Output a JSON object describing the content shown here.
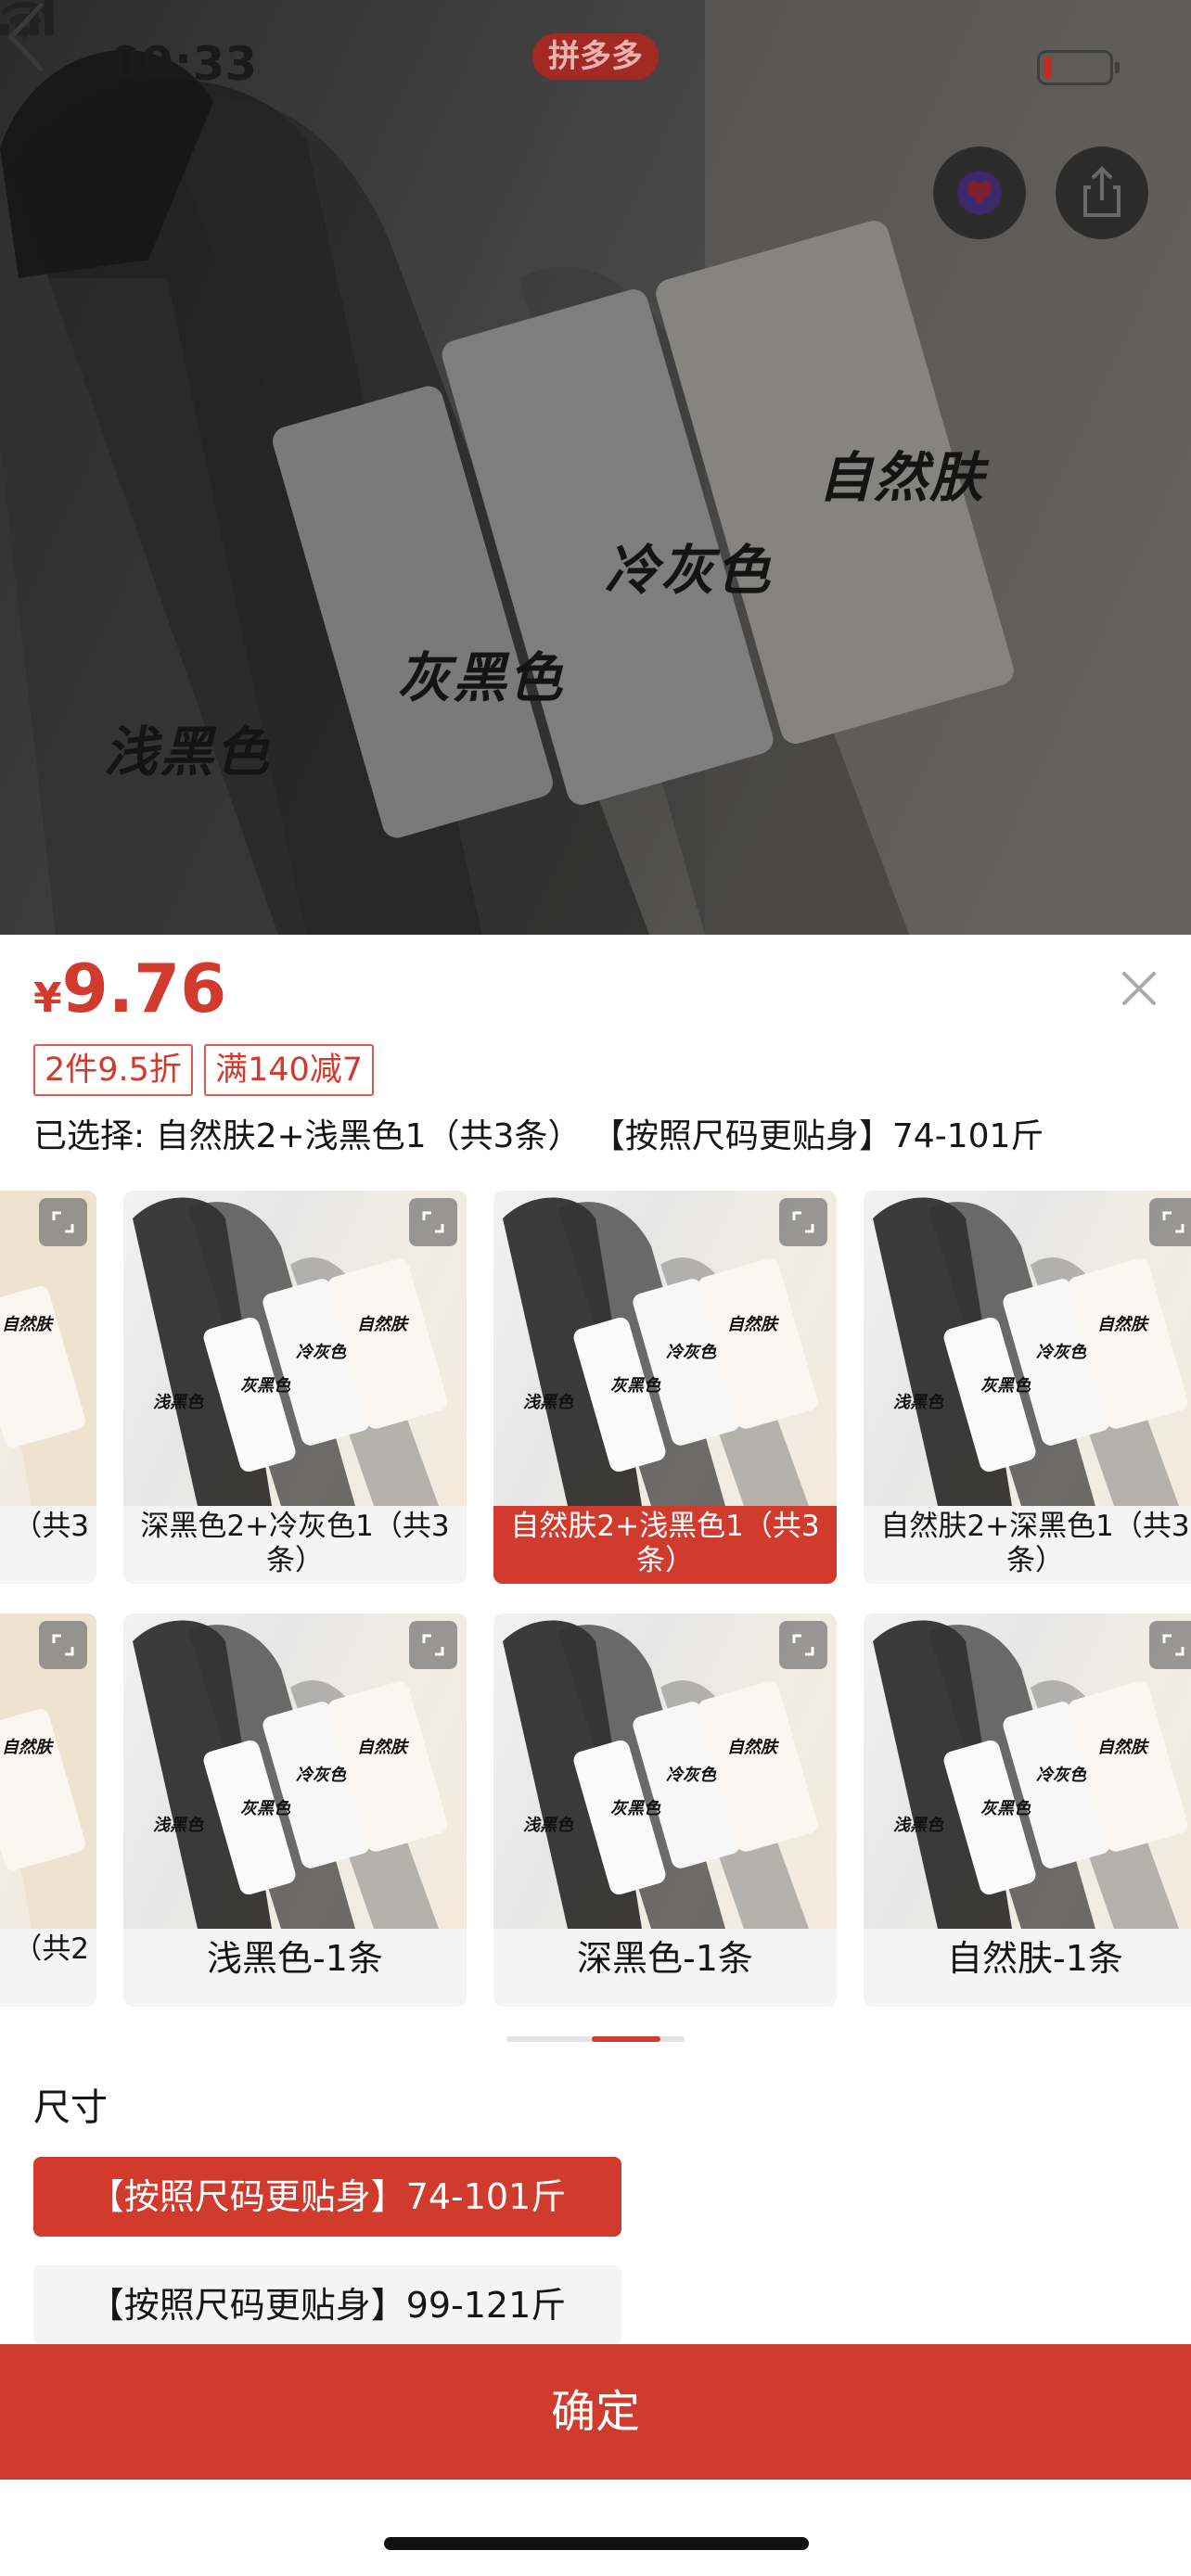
{
  "status_bar": {
    "time": "09:33",
    "app_badge": "拼多多"
  },
  "hero": {
    "labels": [
      "自然肤",
      "冷灰色",
      "灰黑色",
      "浅黑色"
    ]
  },
  "icons": {
    "back": "chevron-left-icon",
    "favorite": "heart-icon",
    "share": "share-icon",
    "close": "close-icon",
    "expand": "expand-icon"
  },
  "product": {
    "currency": "¥",
    "price": "9.76",
    "tags": [
      "2件9.5折",
      "满140减7"
    ],
    "selected_text": "已选择: 自然肤2+浅黑色1（共3条） 【按照尺码更贴身】74-101斤"
  },
  "thumb_labels": {
    "natural": "自然肤",
    "grey": "冷灰色",
    "greyblack": "灰黑色",
    "lightblack": "浅黑色"
  },
  "options_row1": [
    {
      "label": "（共3",
      "selected": false
    },
    {
      "label": "深黑色2+冷灰色1（共3条）",
      "selected": false
    },
    {
      "label": "自然肤2+浅黑色1（共3条）",
      "selected": true
    },
    {
      "label": "自然肤2+深黑色1（共3条）",
      "selected": false
    }
  ],
  "options_row2": [
    {
      "label": "（共2",
      "selected": false
    },
    {
      "label": "浅黑色-1条",
      "selected": false
    },
    {
      "label": "深黑色-1条",
      "selected": false
    },
    {
      "label": "自然肤-1条",
      "selected": false
    }
  ],
  "size": {
    "title": "尺寸",
    "options": [
      {
        "label": "【按照尺码更贴身】74-101斤",
        "selected": true
      },
      {
        "label": "【按照尺码更贴身】99-121斤",
        "selected": false
      }
    ]
  },
  "confirm_label": "确定",
  "colors": {
    "accent": "#d13b2d",
    "sheet_bg": "#ffffff",
    "chip_bg": "#f4f4f4"
  }
}
